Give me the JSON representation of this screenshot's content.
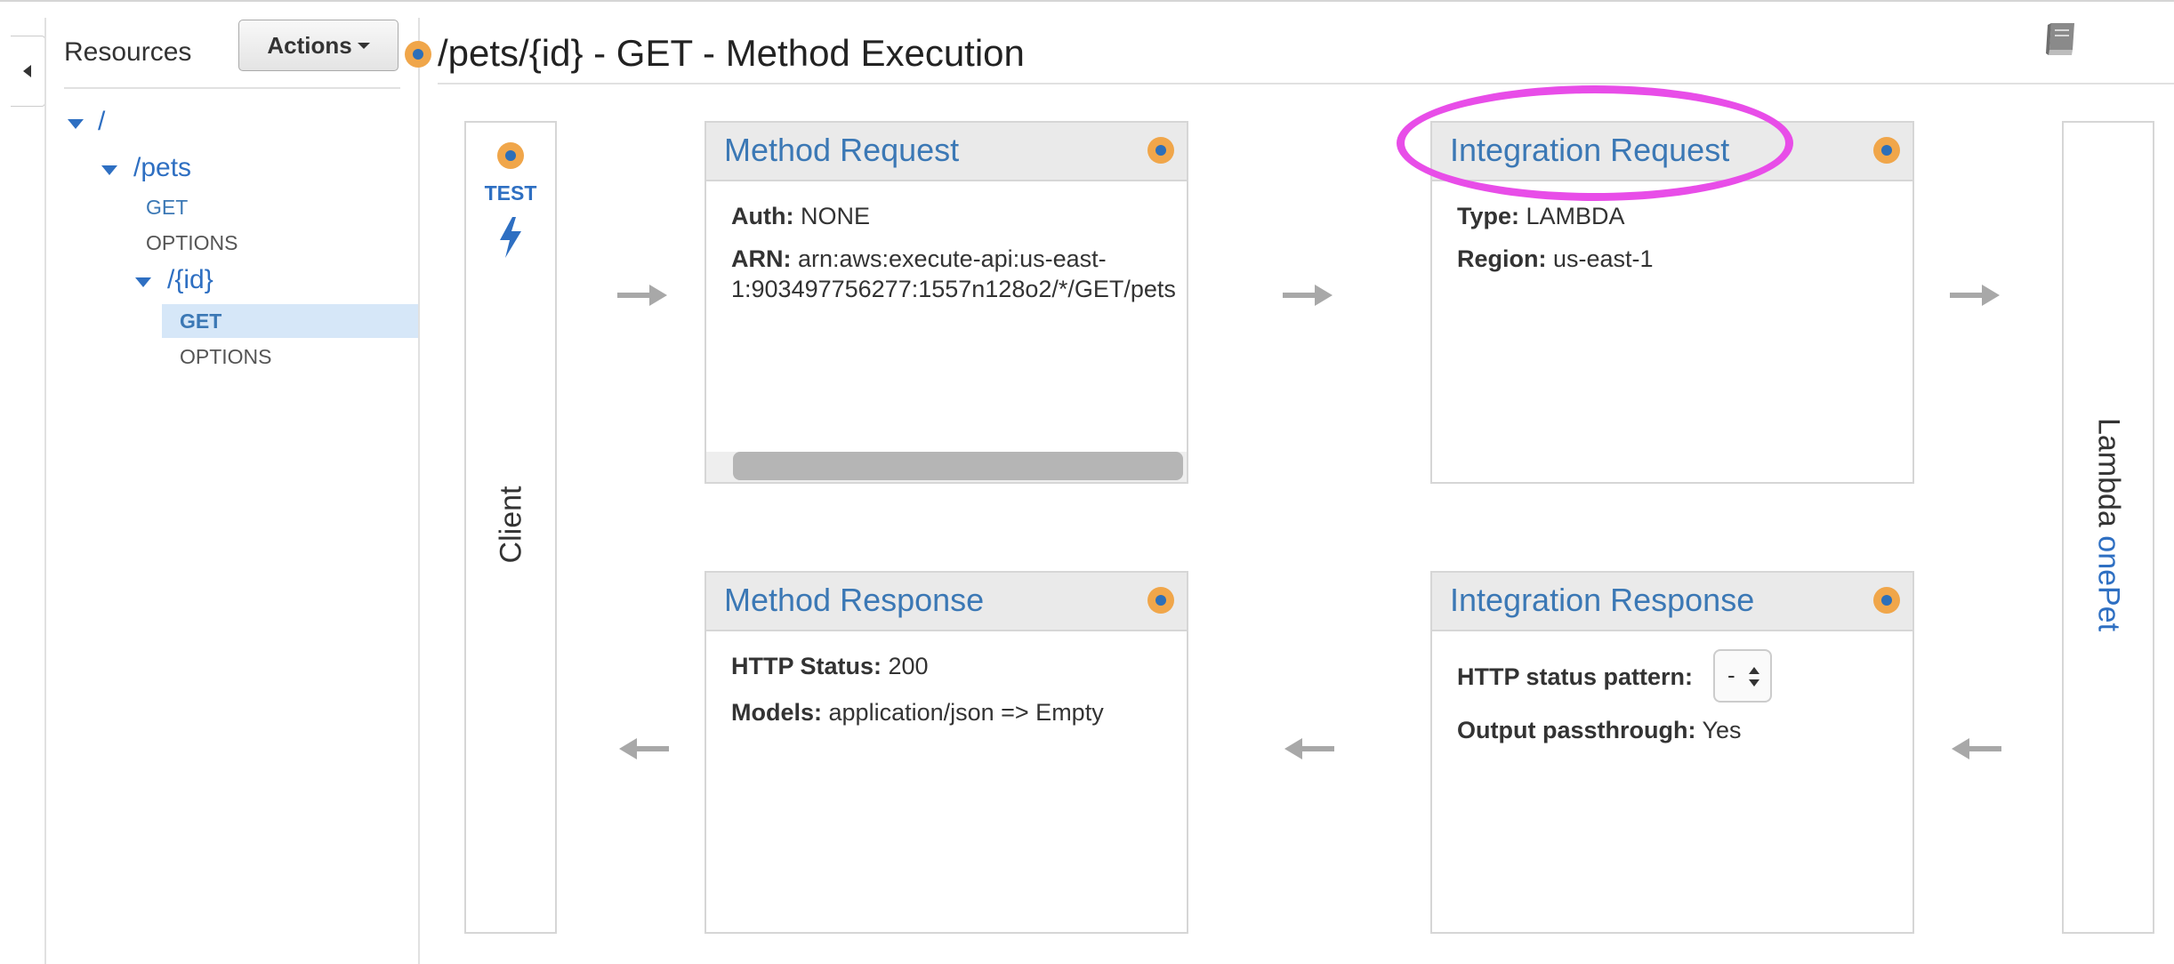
{
  "sidebar": {
    "title": "Resources",
    "actions_label": "Actions",
    "tree": {
      "root": "/",
      "pets": "/pets",
      "pets_get": "GET",
      "pets_options": "OPTIONS",
      "id": "/{id}",
      "id_get": "GET",
      "id_options": "OPTIONS"
    }
  },
  "header": {
    "title": "/pets/{id} - GET - Method Execution"
  },
  "client": {
    "test_label": "TEST",
    "label": "Client"
  },
  "lambda": {
    "prefix": "Lambda ",
    "function": "onePet"
  },
  "method_request": {
    "title": "Method Request",
    "auth_label": "Auth:",
    "auth_value": " NONE",
    "arn_label": "ARN:",
    "arn_line1": " arn:aws:execute-api:us-east-",
    "arn_line2": "1:903497756277:1557n128o2/*/GET/pets"
  },
  "integration_request": {
    "title": "Integration Request",
    "type_label": "Type:",
    "type_value": " LAMBDA",
    "region_label": "Region:",
    "region_value": " us-east-1"
  },
  "method_response": {
    "title": "Method Response",
    "status_label": "HTTP Status:",
    "status_value": " 200",
    "models_label": "Models:",
    "models_value": " application/json => Empty"
  },
  "integration_response": {
    "title": "Integration Response",
    "pattern_label": "HTTP status pattern:",
    "pattern_value": "-",
    "passthrough_label": "Output passthrough:",
    "passthrough_value": " Yes"
  },
  "colors": {
    "link_blue": "#2e6fc2",
    "dot_orange": "#f0a64a",
    "highlight_magenta": "#e84de8",
    "selected_row": "#d6e7f8"
  }
}
